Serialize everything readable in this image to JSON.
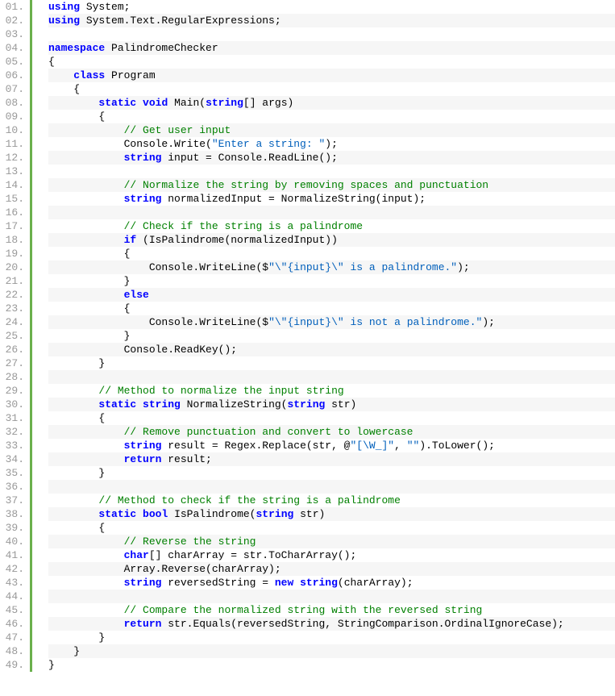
{
  "line_numbers": [
    "01.",
    "02.",
    "03.",
    "04.",
    "05.",
    "06.",
    "07.",
    "08.",
    "09.",
    "10.",
    "11.",
    "12.",
    "13.",
    "14.",
    "15.",
    "16.",
    "17.",
    "18.",
    "19.",
    "20.",
    "21.",
    "22.",
    "23.",
    "24.",
    "25.",
    "26.",
    "27.",
    "28.",
    "29.",
    "30.",
    "31.",
    "32.",
    "33.",
    "34.",
    "35.",
    "36.",
    "37.",
    "38.",
    "39.",
    "40.",
    "41.",
    "42.",
    "43.",
    "44.",
    "45.",
    "46.",
    "47.",
    "48.",
    "49."
  ],
  "code": [
    {
      "indent": 0,
      "parts": [
        {
          "t": "using",
          "c": "kw"
        },
        {
          "t": " System;",
          "c": "plain"
        }
      ]
    },
    {
      "indent": 0,
      "parts": [
        {
          "t": "using",
          "c": "kw"
        },
        {
          "t": " System.Text.RegularExpressions;",
          "c": "plain"
        }
      ]
    },
    {
      "indent": 0,
      "parts": []
    },
    {
      "indent": 0,
      "parts": [
        {
          "t": "namespace",
          "c": "kw"
        },
        {
          "t": " PalindromeChecker",
          "c": "plain"
        }
      ]
    },
    {
      "indent": 0,
      "parts": [
        {
          "t": "{",
          "c": "plain"
        }
      ]
    },
    {
      "indent": 1,
      "parts": [
        {
          "t": "class",
          "c": "kw"
        },
        {
          "t": " Program",
          "c": "plain"
        }
      ]
    },
    {
      "indent": 1,
      "parts": [
        {
          "t": "{",
          "c": "plain"
        }
      ]
    },
    {
      "indent": 2,
      "parts": [
        {
          "t": "static",
          "c": "kw"
        },
        {
          "t": " ",
          "c": "plain"
        },
        {
          "t": "void",
          "c": "kw"
        },
        {
          "t": " Main(",
          "c": "plain"
        },
        {
          "t": "string",
          "c": "type"
        },
        {
          "t": "[] args)",
          "c": "plain"
        }
      ]
    },
    {
      "indent": 2,
      "parts": [
        {
          "t": "{",
          "c": "plain"
        }
      ]
    },
    {
      "indent": 3,
      "parts": [
        {
          "t": "// Get user input",
          "c": "com"
        }
      ]
    },
    {
      "indent": 3,
      "parts": [
        {
          "t": "Console.Write(",
          "c": "plain"
        },
        {
          "t": "\"Enter a string: \"",
          "c": "str"
        },
        {
          "t": ");",
          "c": "plain"
        }
      ]
    },
    {
      "indent": 3,
      "parts": [
        {
          "t": "string",
          "c": "type"
        },
        {
          "t": " input = Console.ReadLine();",
          "c": "plain"
        }
      ]
    },
    {
      "indent": 0,
      "parts": []
    },
    {
      "indent": 3,
      "parts": [
        {
          "t": "// Normalize the string by removing spaces and punctuation",
          "c": "com"
        }
      ]
    },
    {
      "indent": 3,
      "parts": [
        {
          "t": "string",
          "c": "type"
        },
        {
          "t": " normalizedInput = NormalizeString(input);",
          "c": "plain"
        }
      ]
    },
    {
      "indent": 0,
      "parts": []
    },
    {
      "indent": 3,
      "parts": [
        {
          "t": "// Check if the string is a palindrome",
          "c": "com"
        }
      ]
    },
    {
      "indent": 3,
      "parts": [
        {
          "t": "if",
          "c": "kw"
        },
        {
          "t": " (IsPalindrome(normalizedInput))",
          "c": "plain"
        }
      ]
    },
    {
      "indent": 3,
      "parts": [
        {
          "t": "{",
          "c": "plain"
        }
      ]
    },
    {
      "indent": 4,
      "parts": [
        {
          "t": "Console.WriteLine($",
          "c": "plain"
        },
        {
          "t": "\"\\\"{input}\\\" is a palindrome.\"",
          "c": "str"
        },
        {
          "t": ");",
          "c": "plain"
        }
      ]
    },
    {
      "indent": 3,
      "parts": [
        {
          "t": "}",
          "c": "plain"
        }
      ]
    },
    {
      "indent": 3,
      "parts": [
        {
          "t": "else",
          "c": "kw"
        }
      ]
    },
    {
      "indent": 3,
      "parts": [
        {
          "t": "{",
          "c": "plain"
        }
      ]
    },
    {
      "indent": 4,
      "parts": [
        {
          "t": "Console.WriteLine($",
          "c": "plain"
        },
        {
          "t": "\"\\\"{input}\\\" is not a palindrome.\"",
          "c": "str"
        },
        {
          "t": ");",
          "c": "plain"
        }
      ]
    },
    {
      "indent": 3,
      "parts": [
        {
          "t": "}",
          "c": "plain"
        }
      ]
    },
    {
      "indent": 3,
      "parts": [
        {
          "t": "Console.ReadKey();",
          "c": "plain"
        }
      ]
    },
    {
      "indent": 2,
      "parts": [
        {
          "t": "}",
          "c": "plain"
        }
      ]
    },
    {
      "indent": 0,
      "parts": []
    },
    {
      "indent": 2,
      "parts": [
        {
          "t": "// Method to normalize the input string",
          "c": "com"
        }
      ]
    },
    {
      "indent": 2,
      "parts": [
        {
          "t": "static",
          "c": "kw"
        },
        {
          "t": " ",
          "c": "plain"
        },
        {
          "t": "string",
          "c": "type"
        },
        {
          "t": " NormalizeString(",
          "c": "plain"
        },
        {
          "t": "string",
          "c": "type"
        },
        {
          "t": " str)",
          "c": "plain"
        }
      ]
    },
    {
      "indent": 2,
      "parts": [
        {
          "t": "{",
          "c": "plain"
        }
      ]
    },
    {
      "indent": 3,
      "parts": [
        {
          "t": "// Remove punctuation and convert to lowercase",
          "c": "com"
        }
      ]
    },
    {
      "indent": 3,
      "parts": [
        {
          "t": "string",
          "c": "type"
        },
        {
          "t": " result = Regex.Replace(str, @",
          "c": "plain"
        },
        {
          "t": "\"[\\W_]\"",
          "c": "str"
        },
        {
          "t": ", ",
          "c": "plain"
        },
        {
          "t": "\"\"",
          "c": "str"
        },
        {
          "t": ").ToLower();",
          "c": "plain"
        }
      ]
    },
    {
      "indent": 3,
      "parts": [
        {
          "t": "return",
          "c": "kw"
        },
        {
          "t": " result;",
          "c": "plain"
        }
      ]
    },
    {
      "indent": 2,
      "parts": [
        {
          "t": "}",
          "c": "plain"
        }
      ]
    },
    {
      "indent": 0,
      "parts": []
    },
    {
      "indent": 2,
      "parts": [
        {
          "t": "// Method to check if the string is a palindrome",
          "c": "com"
        }
      ]
    },
    {
      "indent": 2,
      "parts": [
        {
          "t": "static",
          "c": "kw"
        },
        {
          "t": " ",
          "c": "plain"
        },
        {
          "t": "bool",
          "c": "type"
        },
        {
          "t": " IsPalindrome(",
          "c": "plain"
        },
        {
          "t": "string",
          "c": "type"
        },
        {
          "t": " str)",
          "c": "plain"
        }
      ]
    },
    {
      "indent": 2,
      "parts": [
        {
          "t": "{",
          "c": "plain"
        }
      ]
    },
    {
      "indent": 3,
      "parts": [
        {
          "t": "// Reverse the string",
          "c": "com"
        }
      ]
    },
    {
      "indent": 3,
      "parts": [
        {
          "t": "char",
          "c": "type"
        },
        {
          "t": "[] charArray = str.ToCharArray();",
          "c": "plain"
        }
      ]
    },
    {
      "indent": 3,
      "parts": [
        {
          "t": "Array.Reverse(charArray);",
          "c": "plain"
        }
      ]
    },
    {
      "indent": 3,
      "parts": [
        {
          "t": "string",
          "c": "type"
        },
        {
          "t": " reversedString = ",
          "c": "plain"
        },
        {
          "t": "new",
          "c": "kw"
        },
        {
          "t": " ",
          "c": "plain"
        },
        {
          "t": "string",
          "c": "type"
        },
        {
          "t": "(charArray);",
          "c": "plain"
        }
      ]
    },
    {
      "indent": 0,
      "parts": []
    },
    {
      "indent": 3,
      "parts": [
        {
          "t": "// Compare the normalized string with the reversed string",
          "c": "com"
        }
      ]
    },
    {
      "indent": 3,
      "parts": [
        {
          "t": "return",
          "c": "kw"
        },
        {
          "t": " str.Equals(reversedString, StringComparison.OrdinalIgnoreCase);",
          "c": "plain"
        }
      ]
    },
    {
      "indent": 2,
      "parts": [
        {
          "t": "}",
          "c": "plain"
        }
      ]
    },
    {
      "indent": 1,
      "parts": [
        {
          "t": "}",
          "c": "plain"
        }
      ]
    },
    {
      "indent": 0,
      "parts": [
        {
          "t": "}",
          "c": "plain"
        }
      ]
    }
  ]
}
